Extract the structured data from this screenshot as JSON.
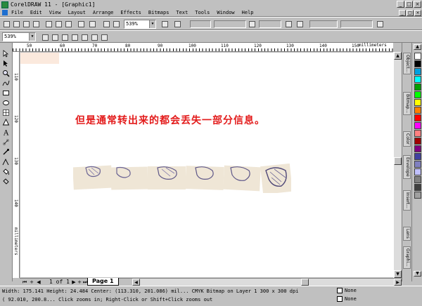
{
  "window": {
    "title": "CorelDRAW 11 - [Graphic1]",
    "btn_min": "_",
    "btn_max": "□",
    "btn_close": "×"
  },
  "menu": [
    "File",
    "Edit",
    "View",
    "Layout",
    "Arrange",
    "Effects",
    "Bitmaps",
    "Text",
    "Tools",
    "Window",
    "Help"
  ],
  "toolbar": {
    "zoom_level": "539%",
    "zoom_level_2": "539%"
  },
  "ruler": {
    "h_numbers": [
      "50",
      "60",
      "70",
      "80",
      "90",
      "100",
      "110",
      "120",
      "130",
      "140",
      "150",
      "160"
    ],
    "h_units": "millimeters",
    "v_units": "millimeters",
    "v_numbers": [
      "110",
      "120",
      "130",
      "140",
      "150"
    ]
  },
  "canvas": {
    "headline": "但是通常转出来的都会丢失一部分信息。"
  },
  "pages": {
    "counter": "1 of 1",
    "tab": "Page 1"
  },
  "dockers": [
    "Object...",
    "Bitmap...",
    "Color",
    "Envelope",
    "Insert...",
    "Lens",
    "Graphi..."
  ],
  "palette_colors": [
    "#ffffff",
    "#000000",
    "#00a0e0",
    "#00ffff",
    "#00a000",
    "#00ff00",
    "#ffff00",
    "#ff8000",
    "#ff0000",
    "#ff00ff",
    "#ff8080",
    "#a00000",
    "#800080",
    "#4040a0",
    "#8080c0",
    "#c0c0ff",
    "#808080",
    "#404040",
    "#a0a0a0"
  ],
  "status": {
    "line1": "Width: 175.141  Height: 24.484  Center: (113.310, 201.086)  mil...  CMYK Bitmap on Layer 1 300 x 300 dpi",
    "line2": "( 92.010, 200.8...  Click zooms in; Right-Click or Shift+Click zooms out",
    "fill_label": "None",
    "outline_label": "None"
  }
}
